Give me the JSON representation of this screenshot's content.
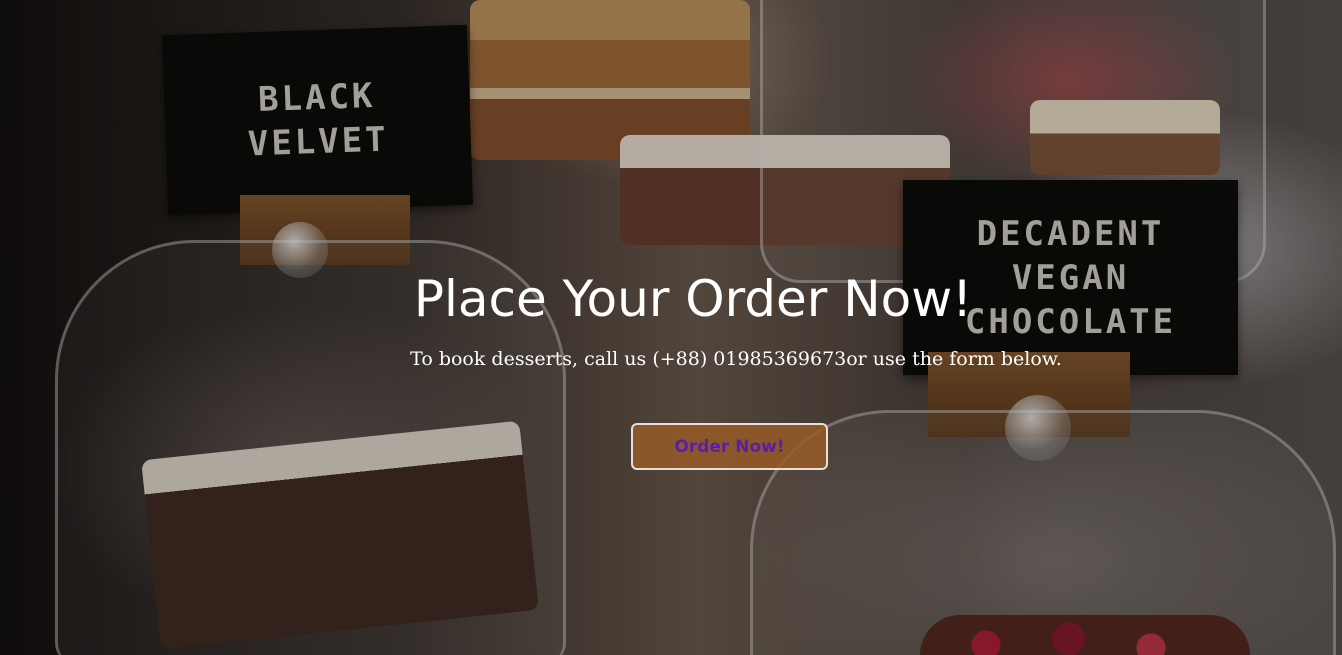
{
  "hero": {
    "title": "Place Your Order Now!",
    "subtitle": "To book desserts, call us (+88) 01985369673or use the form below.",
    "button_label": "Order Now!"
  },
  "background": {
    "sign_left": [
      "BLACK",
      "VELVET"
    ],
    "sign_right": [
      "DECADENT",
      "VEGAN",
      "CHOCOLATE"
    ]
  },
  "colors": {
    "button_text": "#5a1fa8",
    "button_bg": "#965a28",
    "title": "#ffffff"
  }
}
